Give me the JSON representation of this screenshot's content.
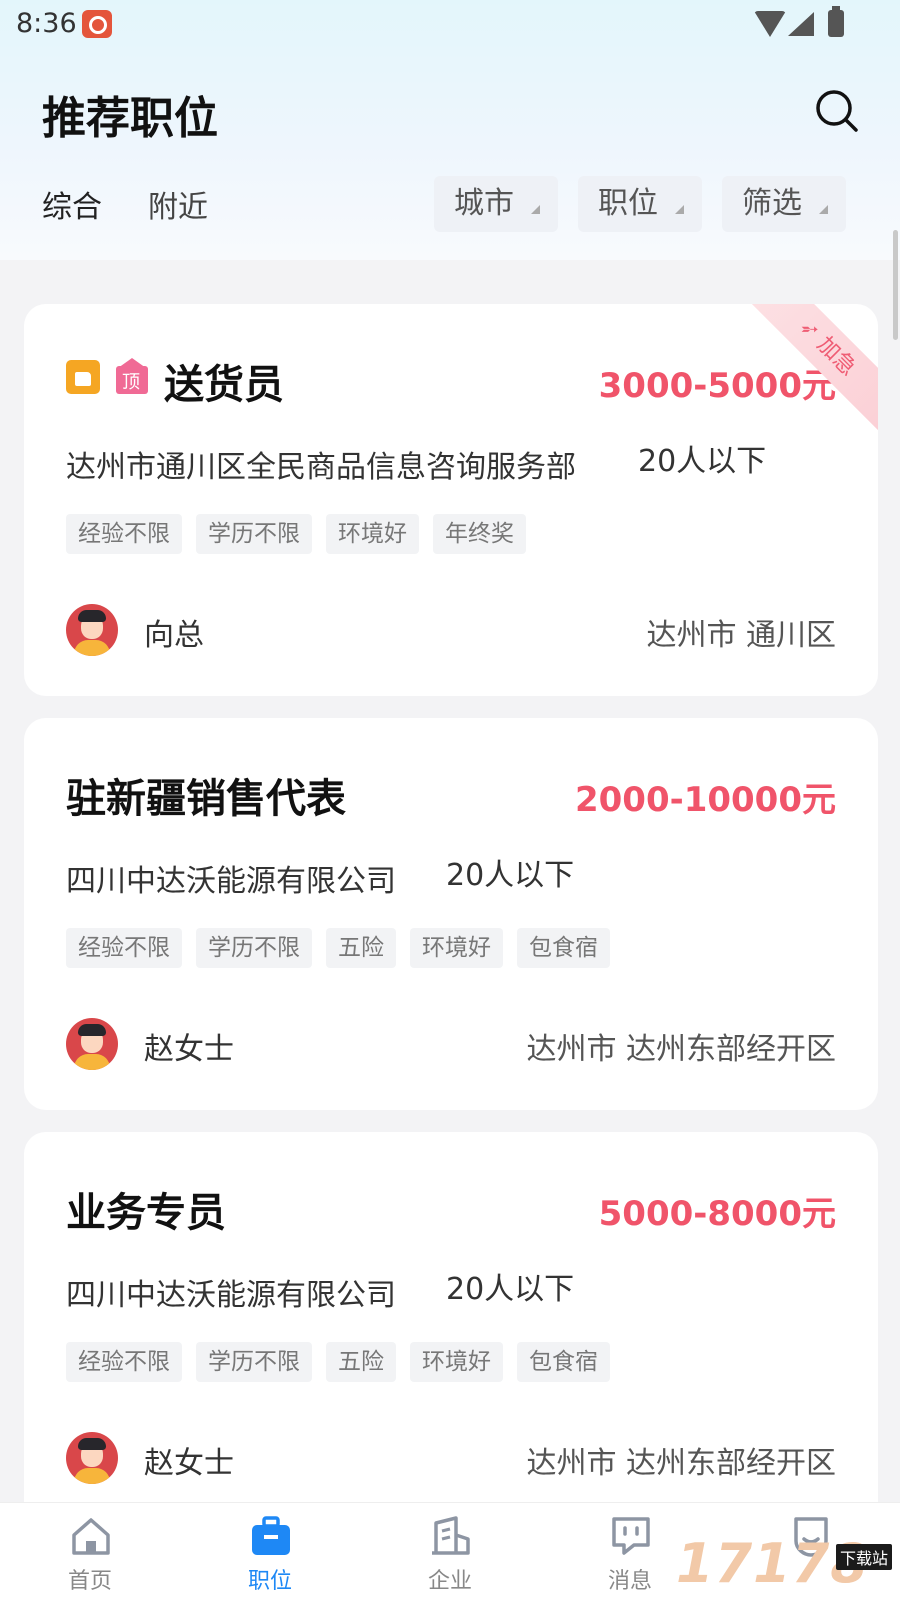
{
  "status_bar": {
    "time": "8:36"
  },
  "header": {
    "title": "推荐职位",
    "tabs": [
      {
        "label": "综合"
      },
      {
        "label": "附近"
      }
    ],
    "filters": [
      {
        "label": "城市"
      },
      {
        "label": "职位"
      },
      {
        "label": "筛选"
      }
    ]
  },
  "jobs": [
    {
      "title": "送货员",
      "salary": "3000-5000元",
      "company": "达州市通川区全民商品信息咨询服务部",
      "size": "20人以下",
      "tags": [
        "经验不限",
        "学历不限",
        "环境好",
        "年终奖"
      ],
      "contact": "向总",
      "location": "达州市 通川区",
      "badge_top": "顶",
      "urgent": "加急"
    },
    {
      "title": "驻新疆销售代表",
      "salary": "2000-10000元",
      "company": "四川中达沃能源有限公司",
      "size": "20人以下",
      "tags": [
        "经验不限",
        "学历不限",
        "五险",
        "环境好",
        "包食宿"
      ],
      "contact": "赵女士",
      "location": "达州市 达州东部经开区"
    },
    {
      "title": "业务专员",
      "salary": "5000-8000元",
      "company": "四川中达沃能源有限公司",
      "size": "20人以下",
      "tags": [
        "经验不限",
        "学历不限",
        "五险",
        "环境好",
        "包食宿"
      ],
      "contact": "赵女士",
      "location": "达州市 达州东部经开区"
    }
  ],
  "bottom_nav": [
    {
      "label": "首页",
      "icon": "home-icon"
    },
    {
      "label": "职位",
      "icon": "briefcase-icon",
      "active": true
    },
    {
      "label": "企业",
      "icon": "building-icon"
    },
    {
      "label": "消息",
      "icon": "message-icon"
    },
    {
      "label": "",
      "icon": "profile-icon"
    }
  ],
  "watermark": {
    "text": "17178",
    "sub": "下载站"
  },
  "colors": {
    "accent": "#1e88f5",
    "salary": "#f0546a"
  }
}
